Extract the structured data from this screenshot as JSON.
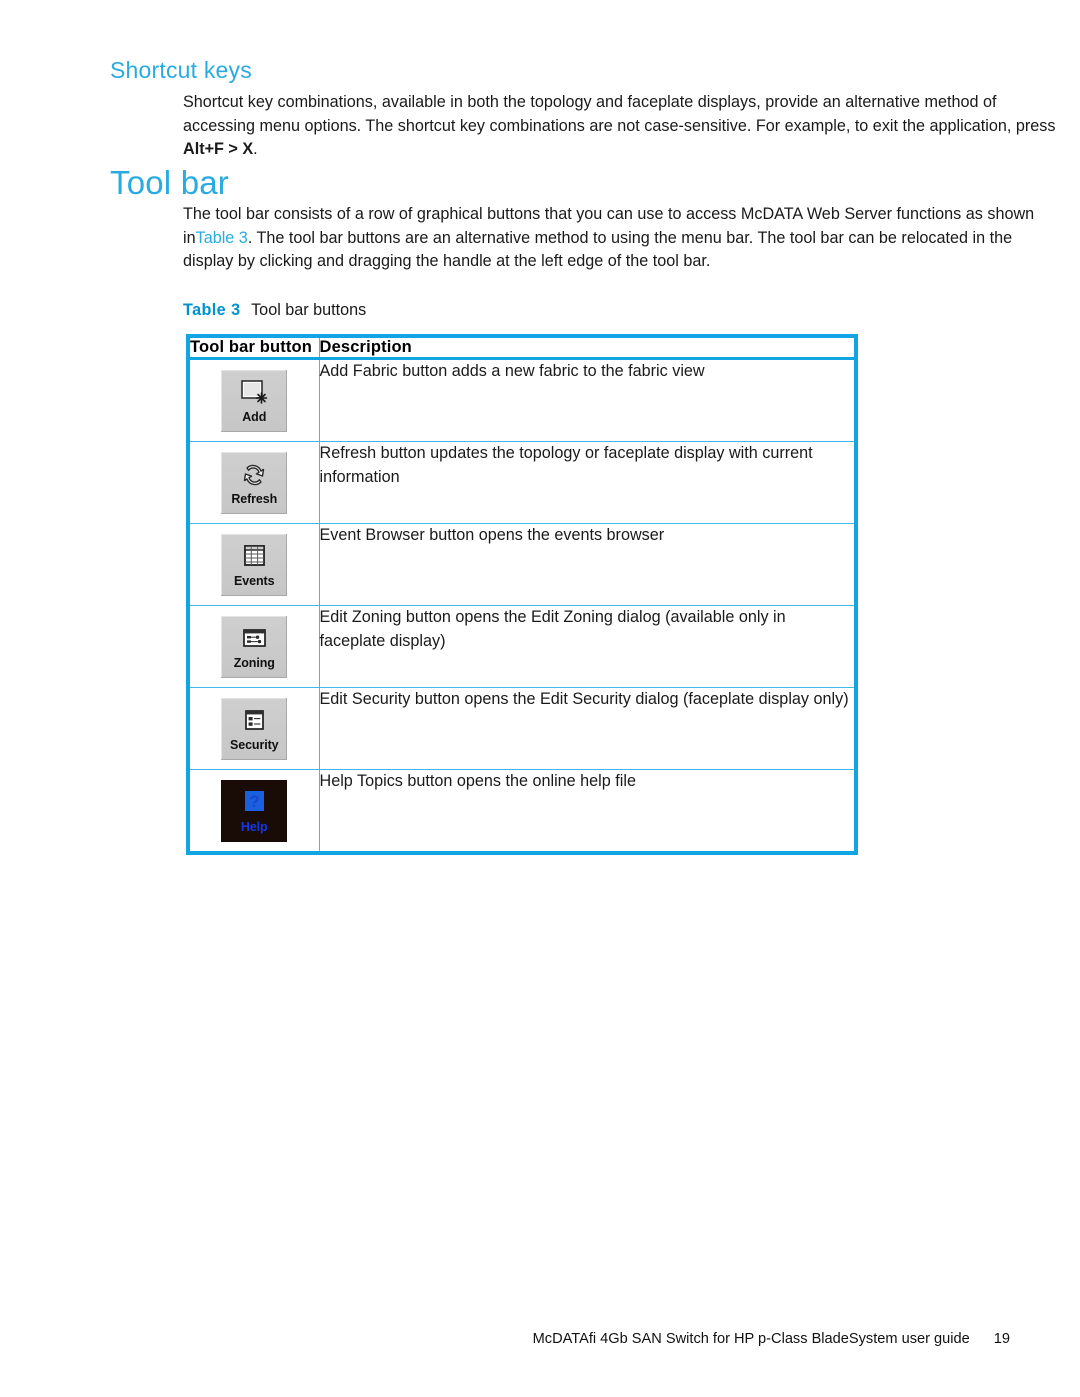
{
  "colors": {
    "accent_blue": "#29ABE2",
    "table_border": "#12A5E4",
    "table_inner_border": "#3FB8EA",
    "caption_blue": "#0092D0",
    "help_label_blue": "#1437E8",
    "button_face": "#c8c8c8"
  },
  "sections": {
    "shortcut_keys": {
      "heading": "Shortcut keys",
      "paragraph_part1": "Shortcut key combinations, available in both the topology and faceplate displays, provide an alternative method of accessing menu options. The shortcut key combinations are not case-sensitive. For example, to exit the application, press ",
      "paragraph_bold": "Alt+F > X",
      "paragraph_part2": "."
    },
    "tool_bar": {
      "heading": "Tool bar",
      "paragraph_part1": "The tool bar consists of a row of graphical buttons that you can use to access McDATA Web Server functions as shown in",
      "paragraph_xref": "Table 3",
      "paragraph_part2": ". The tool bar buttons are an alternative method to using the menu bar. The tool bar can be relocated in the display by clicking and dragging the handle at the left edge of the tool bar."
    }
  },
  "table": {
    "caption_label": "Table",
    "caption_number": "3",
    "caption_text": "Tool bar buttons",
    "columns": [
      "Tool bar button",
      "Description"
    ],
    "rows": [
      {
        "button_label": "Add",
        "icon": "add-fabric-icon",
        "description": "Add Fabric button   adds a new fabric to the fabric view"
      },
      {
        "button_label": "Refresh",
        "icon": "refresh-icon",
        "description": "Refresh button   updates the topology or faceplate display with current information"
      },
      {
        "button_label": "Events",
        "icon": "event-browser-grid-icon",
        "description": "Event Browser button   opens the events browser"
      },
      {
        "button_label": "Zoning",
        "icon": "edit-zoning-window-icon",
        "description": "Edit Zoning button   opens the Edit Zoning dialog (available only in faceplate display)"
      },
      {
        "button_label": "Security",
        "icon": "edit-security-window-icon",
        "description": "Edit Security button   opens the Edit Security dialog (faceplate display only)"
      },
      {
        "button_label": "Help",
        "icon": "help-question-icon",
        "description": "Help Topics button   opens the online help file"
      }
    ]
  },
  "footer": {
    "text": "McDATAfi 4Gb SAN Switch for HP  p-Class BladeSystem user guide",
    "page_number": "19"
  }
}
